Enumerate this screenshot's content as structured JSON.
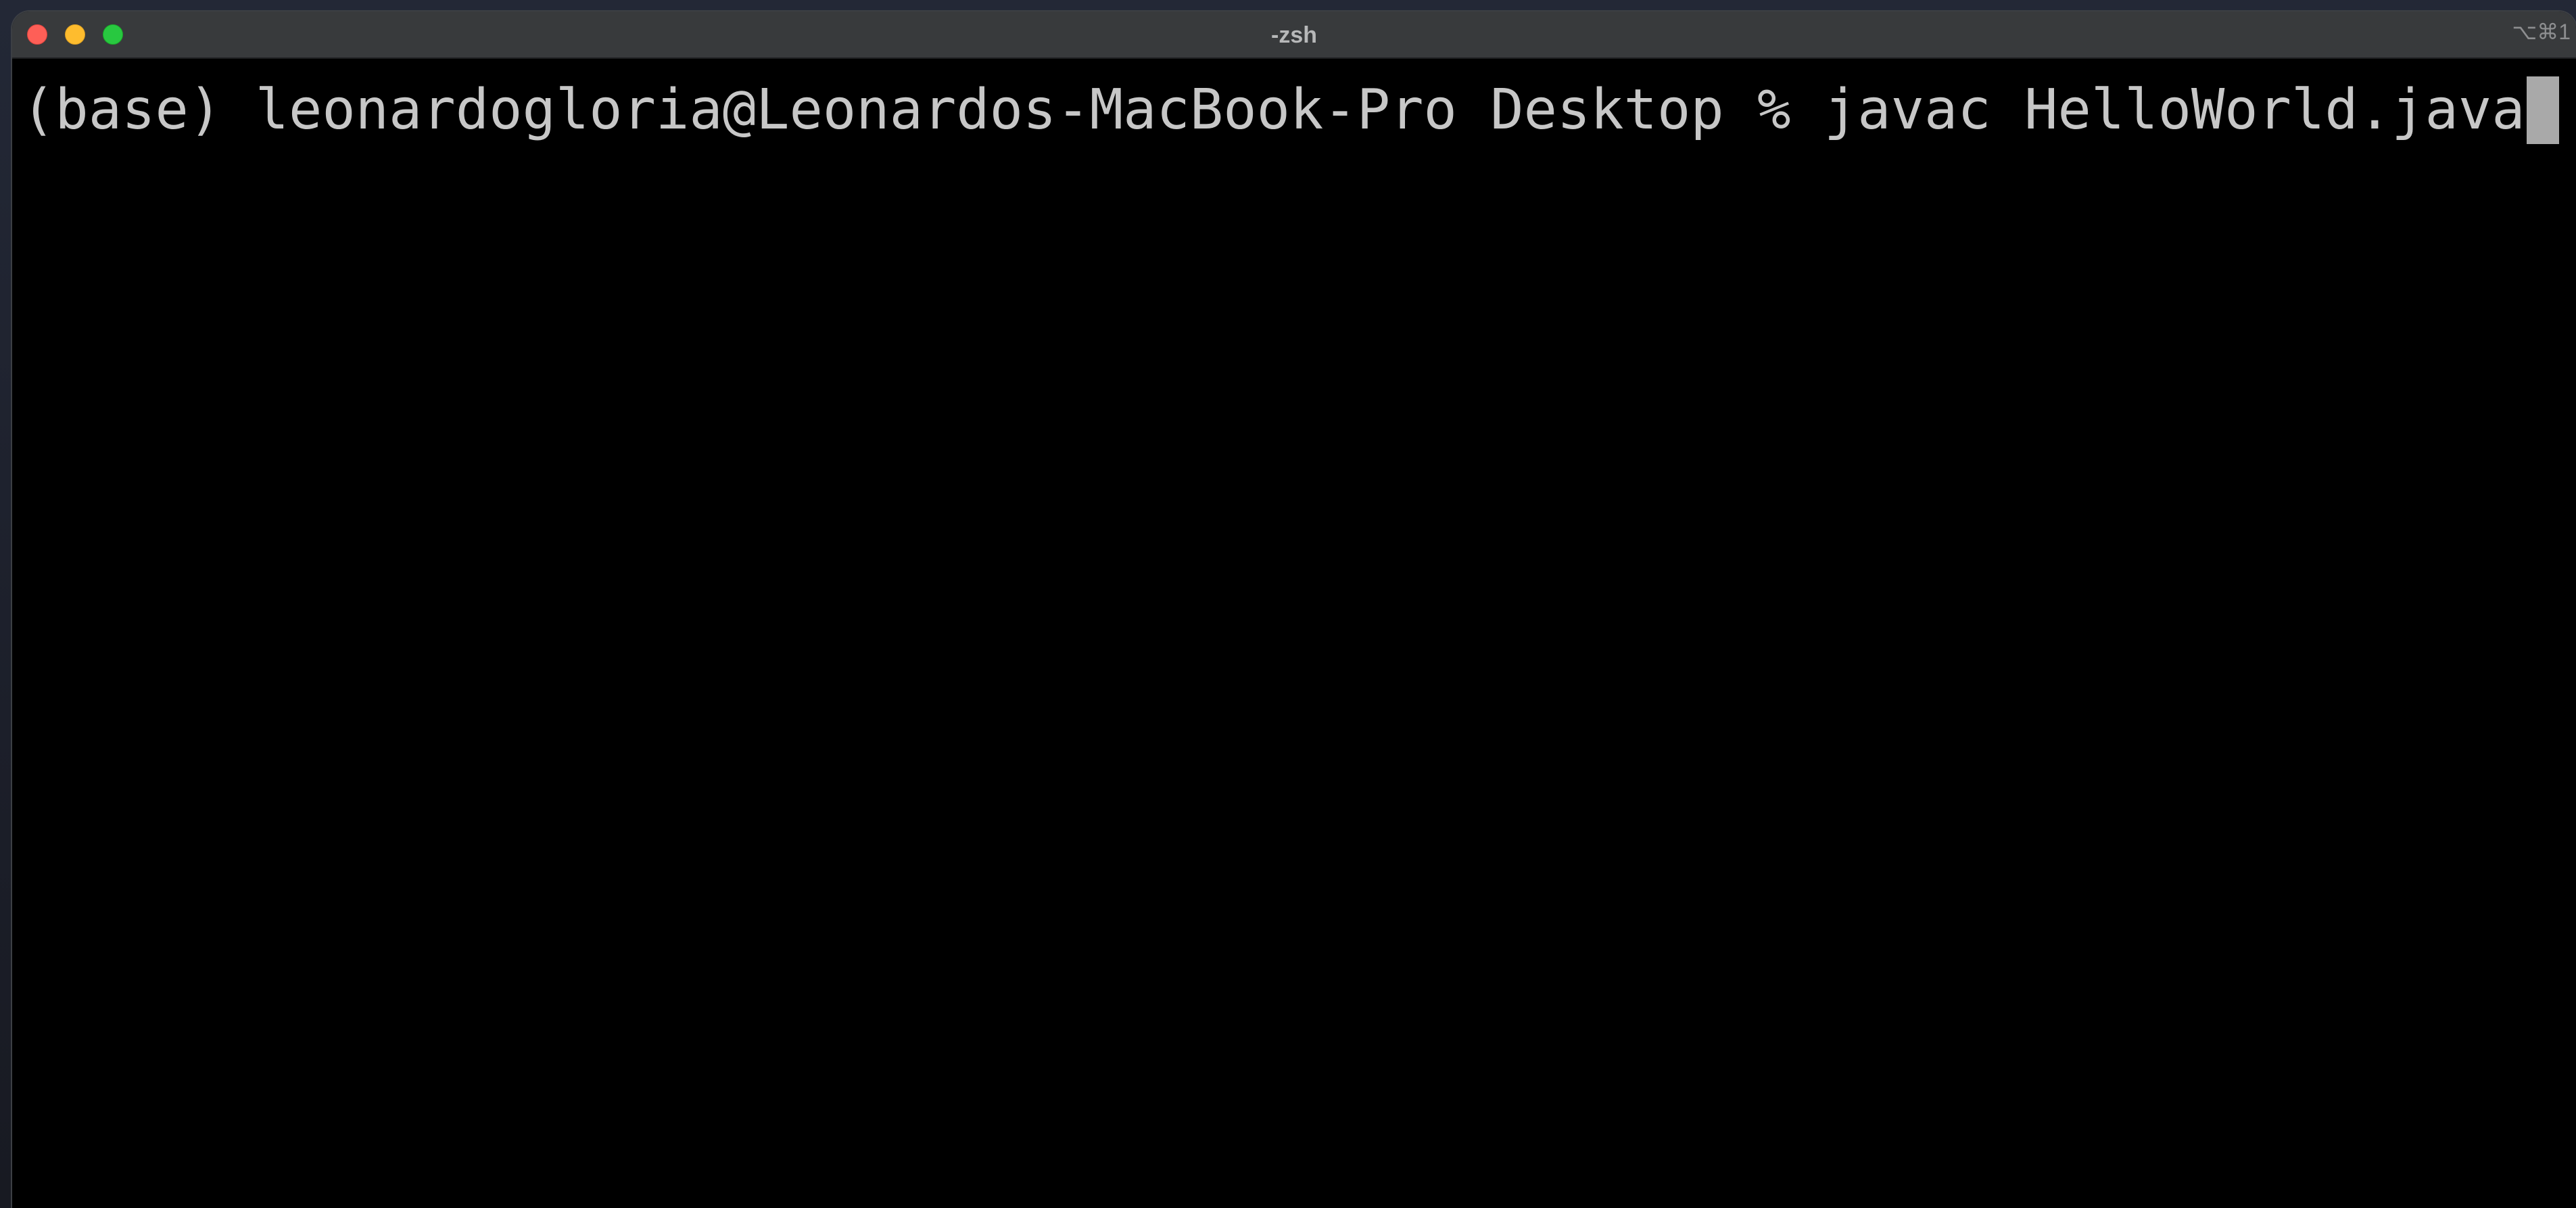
{
  "window": {
    "title": "-zsh",
    "shortcut": "⌥⌘1"
  },
  "terminal": {
    "prompt": "(base) leonardogloria@Leonardos-MacBook-Pro Desktop % ",
    "command": "javac HelloWorld.java"
  },
  "colors": {
    "close": "#fe5f57",
    "minimize": "#febc2e",
    "zoom": "#28c840",
    "terminal_text": "#c7c7c7",
    "terminal_background": "#000000"
  }
}
